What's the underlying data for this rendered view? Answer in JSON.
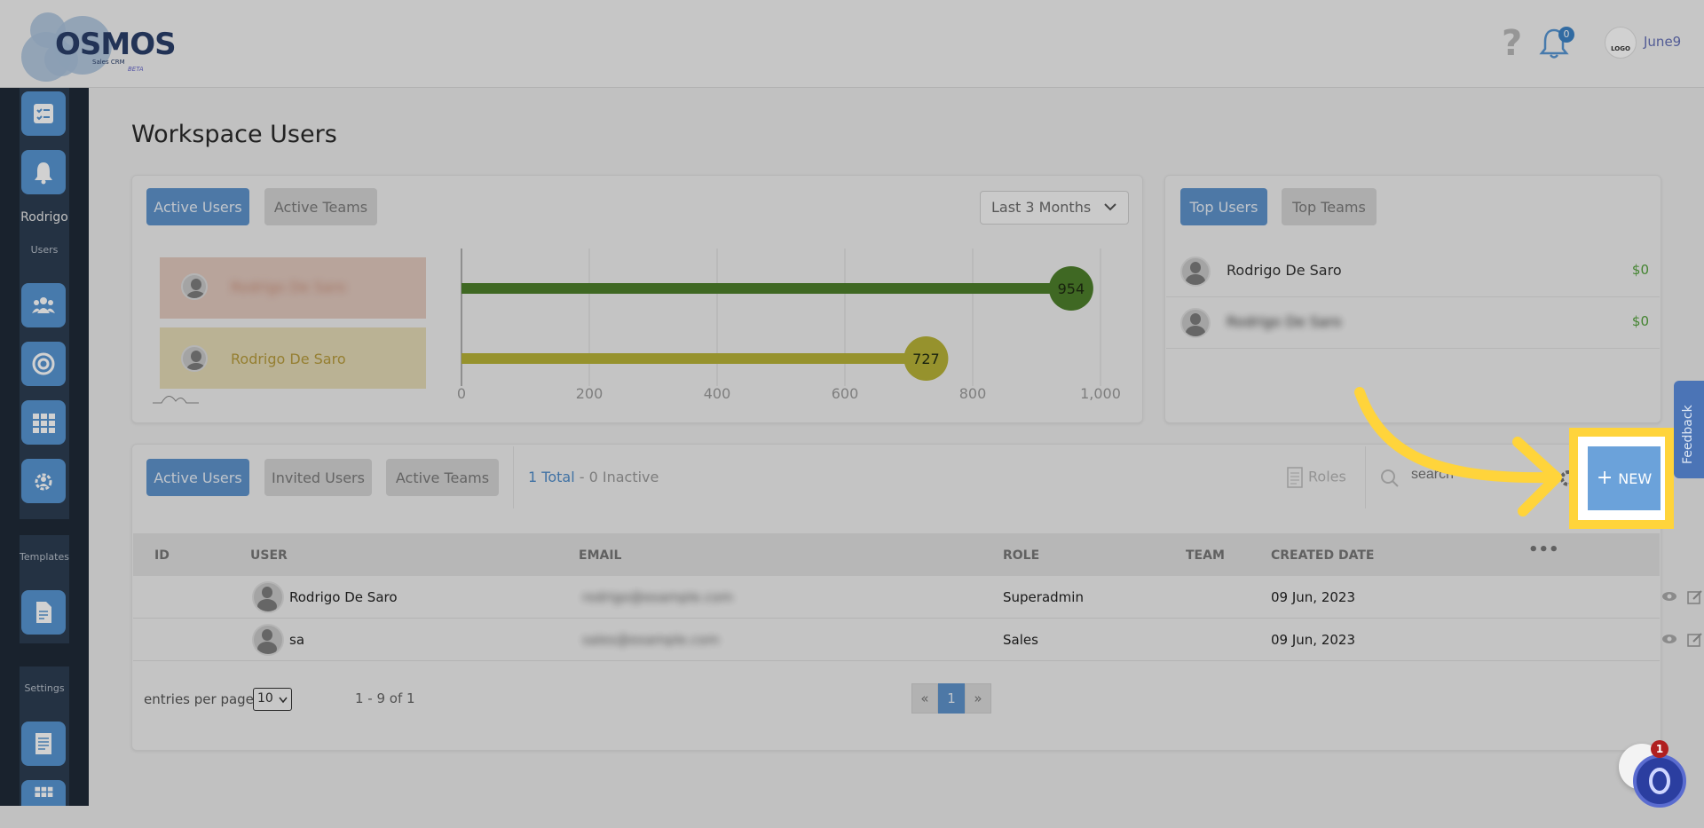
{
  "header": {
    "logo_text": "OSMOS",
    "logo_subtitle": "Sales CRM",
    "logo_beta": "BETA",
    "help_icon": "help-icon",
    "notification_count": "0",
    "avatar_label": "LOGO",
    "username": "June9"
  },
  "sidebar": {
    "user_name": "Rodrigo",
    "section_users": "Users",
    "section_templates": "Templates",
    "section_settings": "Settings"
  },
  "page": {
    "title": "Workspace Users"
  },
  "stats_card": {
    "tabs": [
      "Active Users",
      "Active Teams"
    ],
    "period_select": "Last 3 Months",
    "rows": [
      {
        "name": "Rodrigo De Saro",
        "value": 954,
        "blurred": true
      },
      {
        "name": "Rodrigo De Saro",
        "value": 727,
        "blurred": false
      }
    ]
  },
  "chart_data": {
    "type": "bar",
    "orientation": "horizontal",
    "categories": [
      "Rodrigo De Saro",
      "Rodrigo De Saro"
    ],
    "values": [
      954,
      727
    ],
    "colors": [
      "#4e7f2b",
      "#b7b238"
    ],
    "xlim": [
      0,
      1000
    ],
    "x_ticks": [
      "0",
      "200",
      "400",
      "600",
      "800",
      "1,000"
    ],
    "grid": true
  },
  "top_card": {
    "tabs": [
      "Top Users",
      "Top Teams"
    ],
    "rows": [
      {
        "name": "Rodrigo De Saro",
        "amount": "$0"
      },
      {
        "name": "Rodrigo De Saro",
        "amount": "$0"
      }
    ]
  },
  "users_card": {
    "tabs": [
      "Active Users",
      "Invited Users",
      "Active Teams"
    ],
    "total_text": "1 Total",
    "inactive_text": " - 0 Inactive",
    "roles_label": "Roles",
    "search_placeholder": "search",
    "new_button": "NEW",
    "columns": [
      "ID",
      "USER",
      "EMAIL",
      "ROLE",
      "TEAM",
      "CREATED DATE"
    ],
    "rows": [
      {
        "user": "Rodrigo De Saro",
        "email": "rodrigo@example.com",
        "role": "Superadmin",
        "created": "09 Jun, 2023"
      },
      {
        "user": "sa",
        "email": "sales@example.com",
        "role": "Sales",
        "created": "09 Jun, 2023"
      }
    ],
    "entries_label": "entries per page",
    "entries_value": "10",
    "range_text": "1 - 9 of 1",
    "pages": [
      "«",
      "1",
      "»"
    ]
  },
  "feedback_tab": "Feedback",
  "chat_badge": "1",
  "colors": {
    "accent": "#5e93cb",
    "highlight": "#ffd43b",
    "sidebar": "#1f2a38"
  }
}
